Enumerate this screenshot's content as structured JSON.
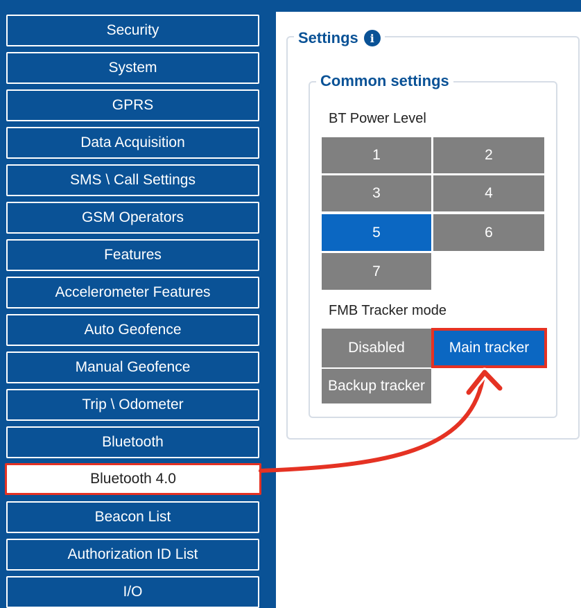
{
  "sidebar": {
    "items": [
      {
        "label": "Security"
      },
      {
        "label": "System"
      },
      {
        "label": "GPRS"
      },
      {
        "label": "Data Acquisition"
      },
      {
        "label": "SMS \\ Call Settings"
      },
      {
        "label": "GSM Operators"
      },
      {
        "label": "Features"
      },
      {
        "label": "Accelerometer Features"
      },
      {
        "label": "Auto Geofence"
      },
      {
        "label": "Manual Geofence"
      },
      {
        "label": "Trip \\ Odometer"
      },
      {
        "label": "Bluetooth"
      },
      {
        "label": "Bluetooth 4.0"
      },
      {
        "label": "Beacon List"
      },
      {
        "label": "Authorization ID List"
      },
      {
        "label": "I/O"
      }
    ],
    "active_item": "Bluetooth 4.0"
  },
  "settings": {
    "title": "Settings",
    "info_icon": "info-icon",
    "common": {
      "title": "Common settings",
      "bt_power": {
        "label": "BT Power Level",
        "options": [
          "1",
          "2",
          "3",
          "4",
          "5",
          "6",
          "7"
        ],
        "selected": "5"
      },
      "tracker_mode": {
        "label": "FMB Tracker mode",
        "options": [
          "Disabled",
          "Main tracker",
          "Backup tracker"
        ],
        "selected": "Main tracker"
      }
    }
  },
  "colors": {
    "sidebar_bg": "#0a5296",
    "selected": "#0b67c2",
    "unselected": "#808080",
    "annotation": "#e53223"
  }
}
